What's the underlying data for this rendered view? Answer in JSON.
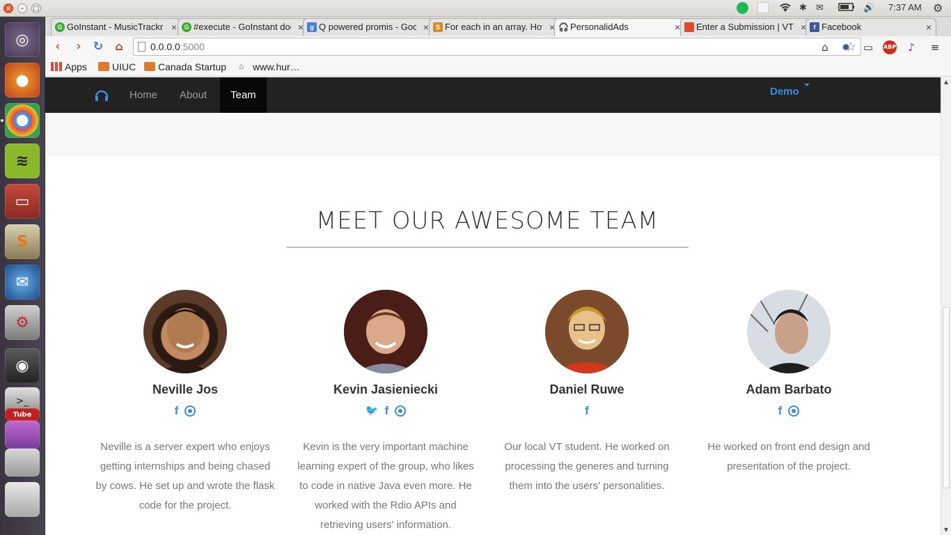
{
  "system": {
    "clock": "7:37 AM"
  },
  "browser": {
    "tabs": [
      {
        "label": "GoInstant - MusicTrackr",
        "favicon_color": "#3aaa2a",
        "favicon_text": "G"
      },
      {
        "label": "#execute - GoInstant docs",
        "favicon_color": "#3aaa2a",
        "favicon_text": "G"
      },
      {
        "label": "Q powered promis - Google",
        "favicon_color": "#4a7fe0",
        "favicon_text": "g"
      },
      {
        "label": "For each in an array. How",
        "favicon_color": "#d98b2a",
        "favicon_text": "S"
      },
      {
        "label": "PersonalidAds",
        "favicon_color": "#555555",
        "favicon_text": ""
      },
      {
        "label": "Enter a Submission | VT",
        "favicon_color": "#e04a2a",
        "favicon_text": ""
      },
      {
        "label": "Facebook",
        "favicon_color": "#3b5998",
        "favicon_text": "f"
      }
    ],
    "active_tab_index": 4,
    "address": {
      "host": "0.0.0.0",
      "port": ":5000"
    },
    "bookmarks": [
      {
        "label": "Apps",
        "icon": "apps-grid-icon"
      },
      {
        "label": "UIUC",
        "icon": "folder-icon"
      },
      {
        "label": "Canada Startup",
        "icon": "folder-icon"
      },
      {
        "label": "www.hur…",
        "icon": "site-icon"
      }
    ]
  },
  "site": {
    "nav": {
      "links": [
        "Home",
        "About",
        "Team"
      ],
      "active": "Team",
      "demo_label": "Demo"
    },
    "heading": "MEET OUR AWESOME TEAM",
    "members": [
      {
        "name": "Neville Jos",
        "socials": [
          "facebook",
          "github"
        ],
        "bio": "Neville is a server expert who enjoys getting internships and being chased by cows. He set up and wrote the flask code for the project.",
        "avatar_palette": [
          "#5a3a28",
          "#c48a62",
          "#2a1a12"
        ]
      },
      {
        "name": "Kevin Jasieniecki",
        "socials": [
          "twitter",
          "facebook",
          "github"
        ],
        "bio": "Kevin is the very important machine learning expert of the group, who likes to code in native Java even more. He worked with the Rdio APIs and retrieving users' information.",
        "avatar_palette": [
          "#3a1a14",
          "#d9a88a",
          "#5a2a20"
        ]
      },
      {
        "name": "Daniel Ruwe",
        "socials": [
          "facebook"
        ],
        "bio": "Our local VT student. He worked on processing the generes and turning them into the users' personalities.",
        "avatar_palette": [
          "#c43a1a",
          "#e8c08a",
          "#b8862a"
        ]
      },
      {
        "name": "Adam Barbato",
        "socials": [
          "facebook",
          "github"
        ],
        "bio": "He worked on front end design and presentation of the project.",
        "avatar_palette": [
          "#2a2a2a",
          "#c9a08a",
          "#e0e4ea"
        ]
      }
    ]
  },
  "colors": {
    "accent": "#3a8fd8",
    "navbar": "#222222"
  }
}
